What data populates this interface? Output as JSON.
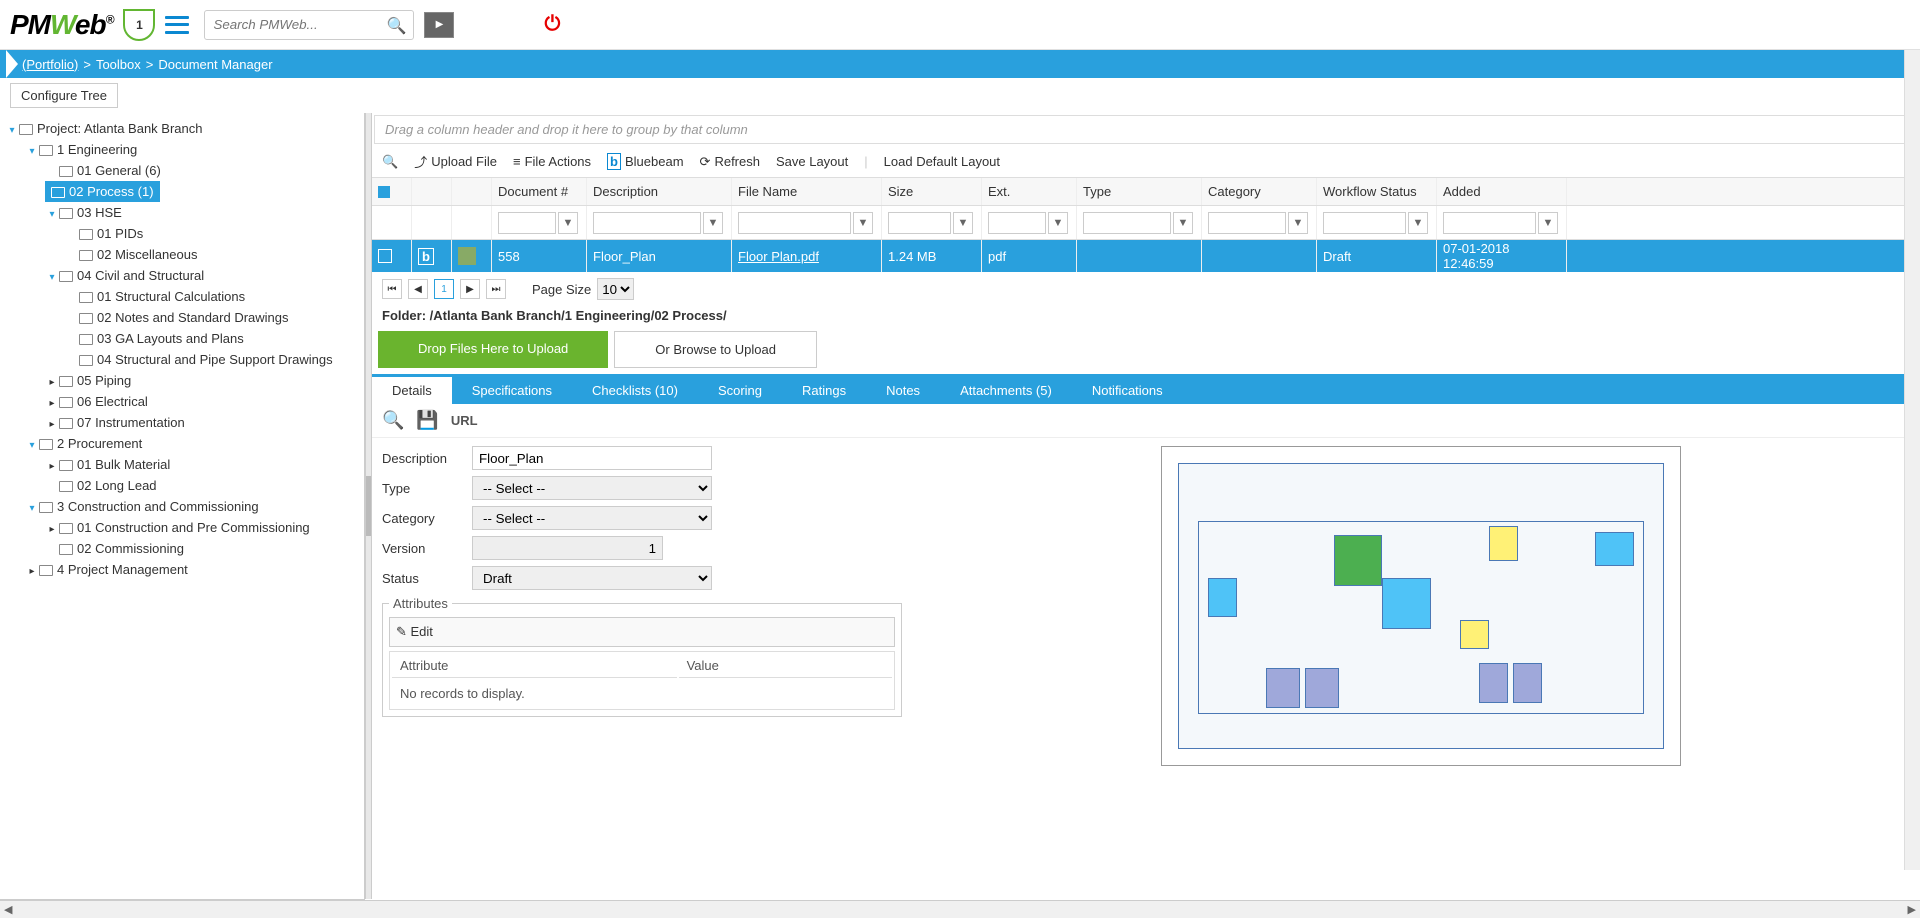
{
  "header": {
    "logo_text_pm": "PM",
    "logo_text_w": "W",
    "logo_text_eb": "eb",
    "logo_reg": "®",
    "shield_badge": "1",
    "search_placeholder": "Search PMWeb..."
  },
  "breadcrumb": {
    "portfolio": "(Portfolio)",
    "toolbox": "Toolbox",
    "docmgr": "Document Manager",
    "sep": ">"
  },
  "configure_tree": "Configure Tree",
  "tree": {
    "root": "Project: Atlanta Bank Branch",
    "n1": "1 Engineering",
    "n1_1": "01 General (6)",
    "n1_2": "02 Process (1)",
    "n1_3": "03 HSE",
    "n1_3_1": "01 PIDs",
    "n1_3_2": "02 Miscellaneous",
    "n1_4": "04 Civil and Structural",
    "n1_4_1": "01 Structural Calculations",
    "n1_4_2": "02 Notes and Standard Drawings",
    "n1_4_3": "03 GA Layouts and Plans",
    "n1_4_4": "04 Structural and Pipe Support Drawings",
    "n1_5": "05 Piping",
    "n1_6": "06 Electrical",
    "n1_7": "07 Instrumentation",
    "n2": "2 Procurement",
    "n2_1": "01 Bulk Material",
    "n2_2": "02 Long Lead",
    "n3": "3 Construction and Commissioning",
    "n3_1": "01 Construction and Pre Commissioning",
    "n3_2": "02 Commissioning",
    "n4": "4 Project Management"
  },
  "grid": {
    "group_hint": "Drag a column header and drop it here to group by that column",
    "toolbar": {
      "upload": "Upload File",
      "actions": "File Actions",
      "bluebeam": "Bluebeam",
      "refresh": "Refresh",
      "save_layout": "Save Layout",
      "load_layout": "Load Default Layout",
      "sep": "|"
    },
    "cols": {
      "doc": "Document #",
      "desc": "Description",
      "file": "File Name",
      "size": "Size",
      "ext": "Ext.",
      "type": "Type",
      "cat": "Category",
      "wf": "Workflow Status",
      "added": "Added"
    },
    "row": {
      "doc": "558",
      "desc": "Floor_Plan",
      "file": "Floor Plan.pdf",
      "size": "1.24 MB",
      "ext": "pdf",
      "type": "",
      "cat": "",
      "wf": "Draft",
      "added": "07-01-2018 12:46:59"
    },
    "pager": {
      "page": "1",
      "page_size_label": "Page Size",
      "page_size": "10"
    },
    "folder_label": "Folder: /Atlanta Bank Branch/1 Engineering/02 Process/",
    "drop": "Drop Files Here to Upload",
    "browse": "Or Browse to Upload"
  },
  "tabs": {
    "details": "Details",
    "spec": "Specifications",
    "check": "Checklists (10)",
    "scoring": "Scoring",
    "ratings": "Ratings",
    "notes": "Notes",
    "attach": "Attachments (5)",
    "notif": "Notifications"
  },
  "details": {
    "url_label": "URL",
    "desc_label": "Description",
    "desc_val": "Floor_Plan",
    "type_label": "Type",
    "select_ph": "-- Select --",
    "cat_label": "Category",
    "ver_label": "Version",
    "ver_val": "1",
    "status_label": "Status",
    "status_val": "Draft",
    "attributes_legend": "Attributes",
    "edit": "Edit",
    "attr_col": "Attribute",
    "val_col": "Value",
    "no_records": "No records to display."
  }
}
